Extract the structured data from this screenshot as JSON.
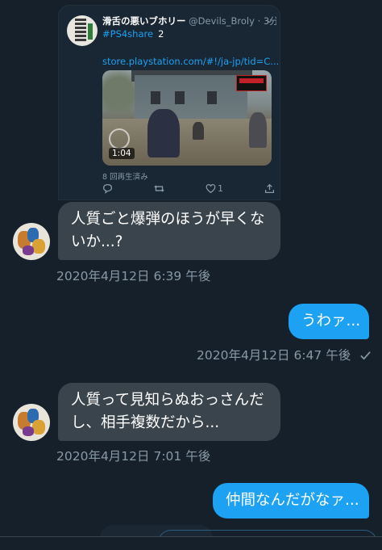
{
  "tweet": {
    "name": "滑舌の悪いブホリー",
    "handle": "@Devils_Broly",
    "time": "· 3分",
    "hashtag": "#PS4share",
    "hashtag_suffix": "2",
    "link": "store.playstation.com/#!/ja-jp/tid=C...",
    "video_duration": "1:04",
    "views": "8 回再生済み",
    "like_count": "1"
  },
  "messages": [
    {
      "direction": "incoming",
      "text": "人質ごと爆弾のほうが早くないか...?",
      "timestamp": "2020年4月12日 6:39 午後"
    },
    {
      "direction": "outgoing",
      "text": "うわァ...",
      "timestamp": "2020年4月12日 6:47 午後"
    },
    {
      "direction": "incoming",
      "text": "人質って見知らぬおっさんだし、相手複数だから...",
      "timestamp": "2020年4月12日 7:01 午後"
    },
    {
      "direction": "outgoing",
      "text": "仲間なんだがなァ..."
    }
  ],
  "colors": {
    "background": "#15202b",
    "incoming_bubble": "#3a444c",
    "outgoing_bubble": "#1da1f2",
    "secondary_text": "#8899a6"
  }
}
